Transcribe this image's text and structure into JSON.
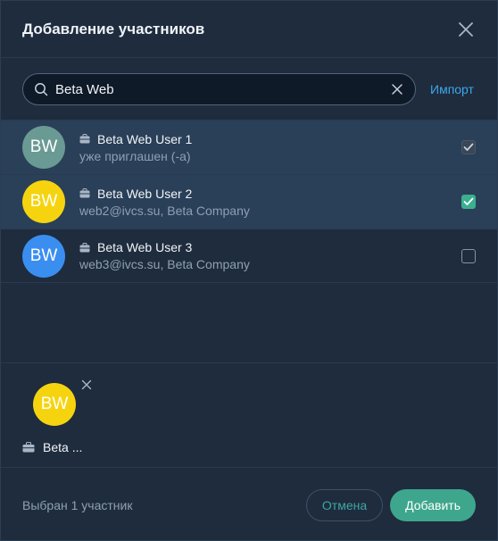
{
  "dialog": {
    "title": "Добавление участников",
    "close_icon": "close-icon"
  },
  "search": {
    "value": "Beta Web",
    "search_icon": "search-icon",
    "clear_icon": "clear-icon",
    "import_label": "Импорт"
  },
  "users": [
    {
      "initials": "BW",
      "avatar_color": "#6a9a94",
      "name": "Beta Web User 1",
      "subtitle": "уже приглашен (-а)",
      "state": "checked-disabled"
    },
    {
      "initials": "BW",
      "avatar_color": "#f5d40f",
      "name": "Beta Web User 2",
      "subtitle": "web2@ivcs.su, Beta Company",
      "state": "checked"
    },
    {
      "initials": "BW",
      "avatar_color": "#3a8ef0",
      "name": "Beta Web User 3",
      "subtitle": "web3@ivcs.su, Beta Company",
      "state": "unchecked"
    }
  ],
  "selected": [
    {
      "initials": "BW",
      "avatar_color": "#f5d40f",
      "label": "Beta ..."
    }
  ],
  "footer": {
    "count_text": "Выбран 1 участник",
    "cancel_label": "Отмена",
    "add_label": "Добавить"
  },
  "colors": {
    "background": "#1e2c3e",
    "selected_row": "#2a3f58",
    "accent": "#3ea68d",
    "link": "#3fa6e8"
  }
}
